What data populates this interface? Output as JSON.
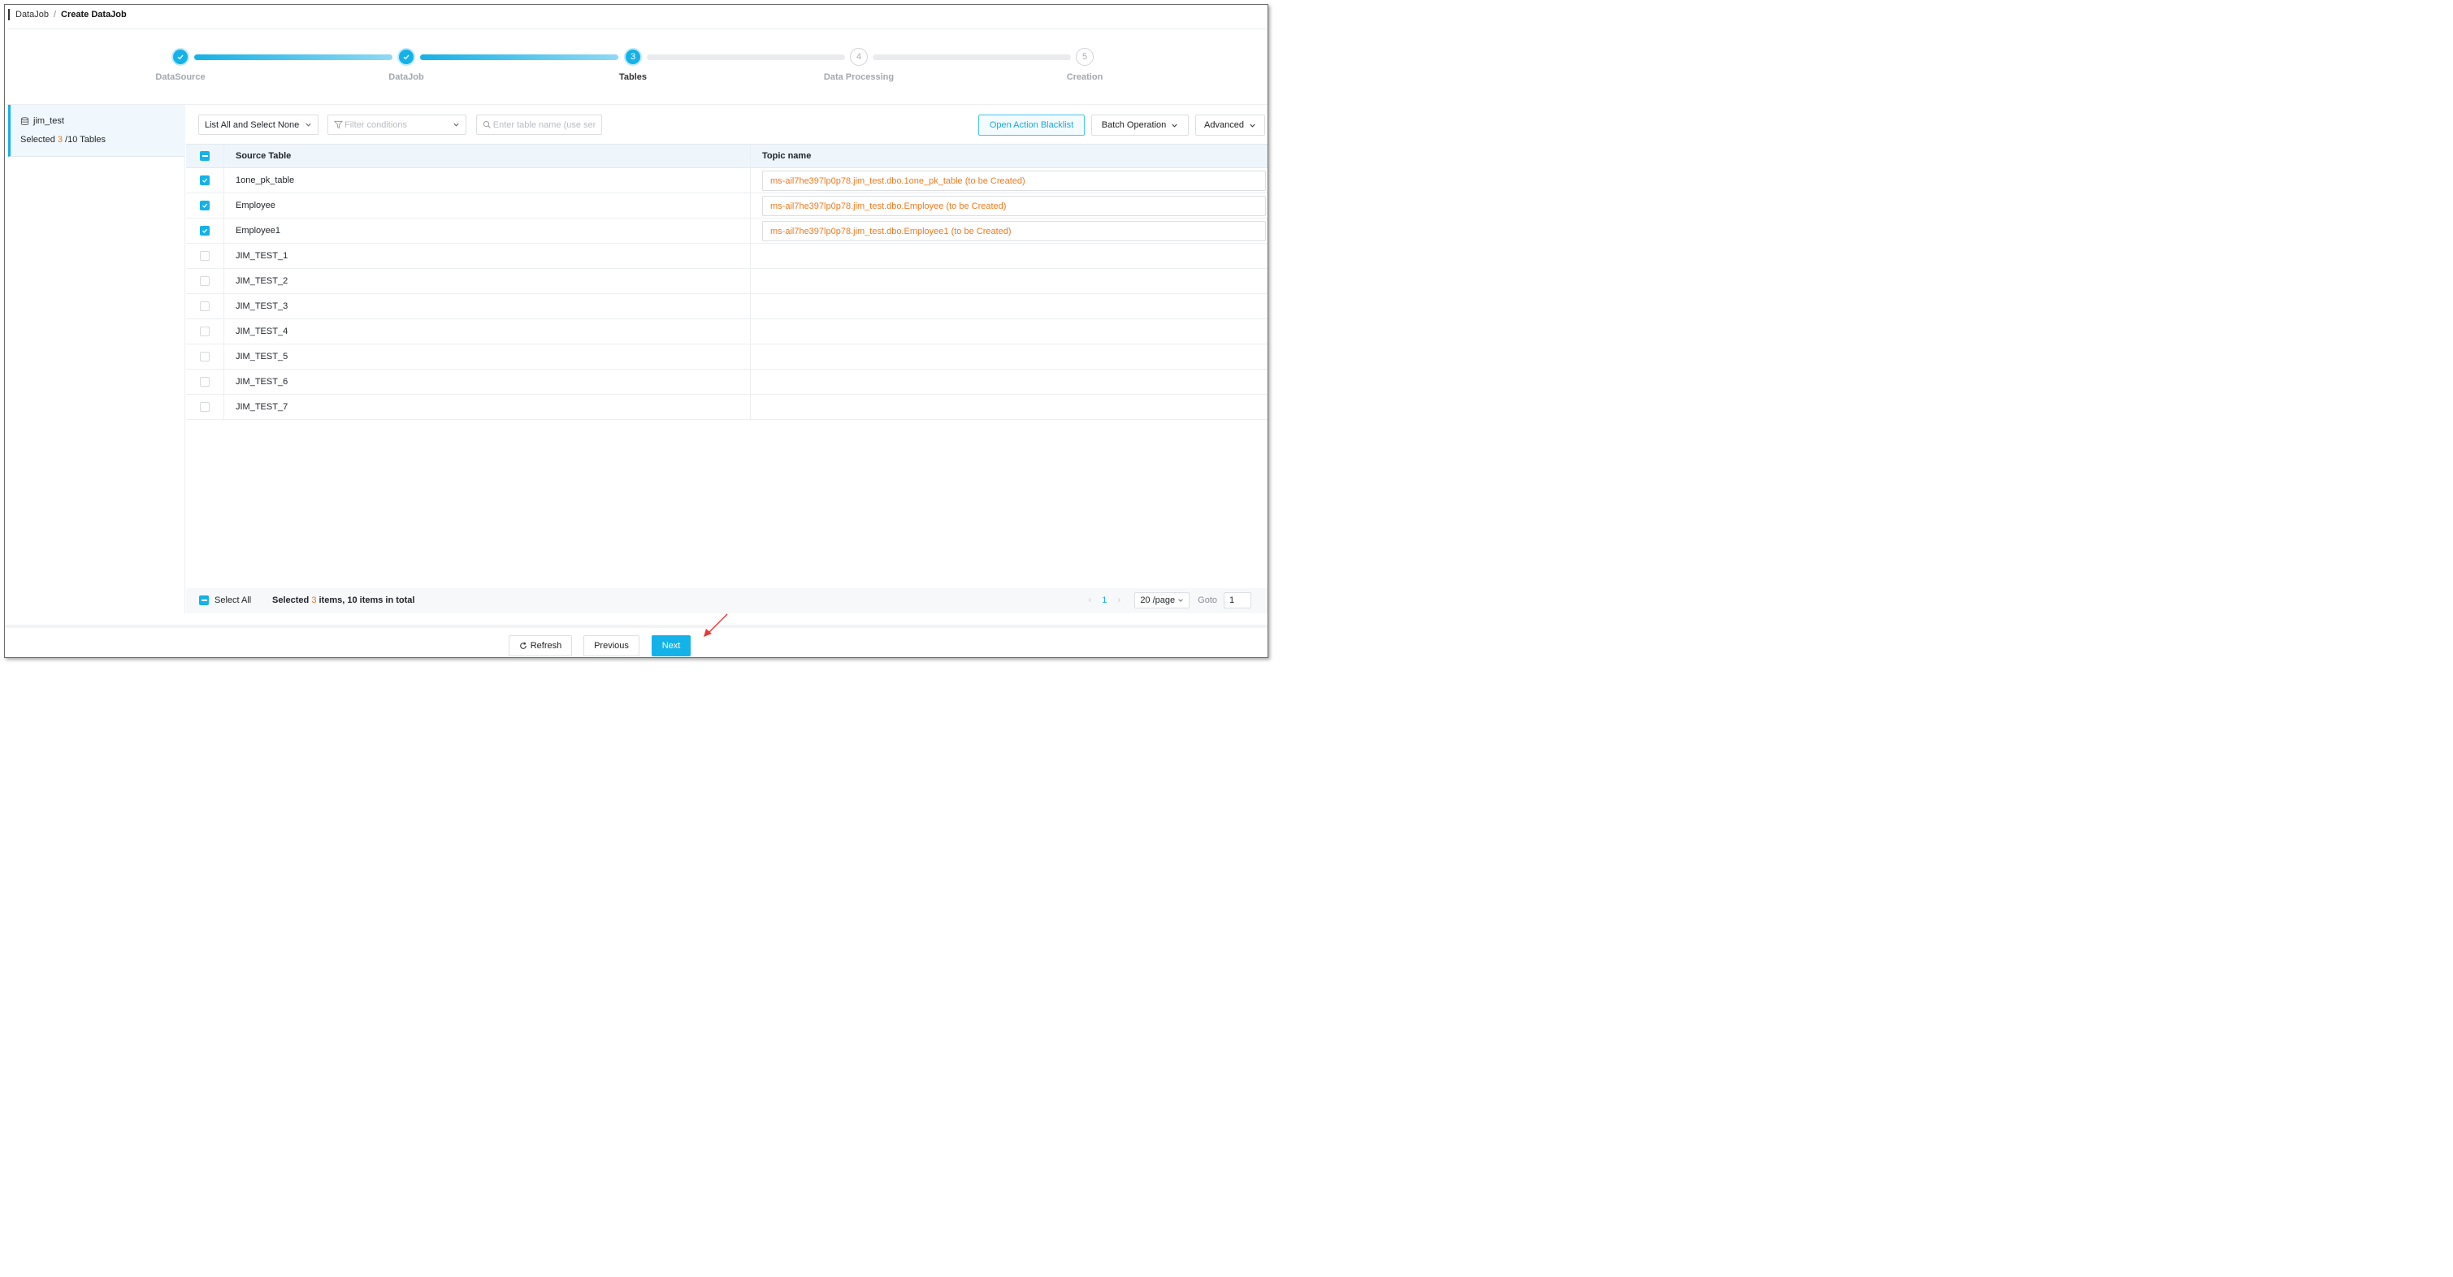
{
  "breadcrumb": {
    "items": [
      "DataJob",
      "Create DataJob"
    ],
    "separator": "/"
  },
  "steps": [
    {
      "label": "DataSource",
      "state": "done",
      "number": "1"
    },
    {
      "label": "DataJob",
      "state": "done",
      "number": "2"
    },
    {
      "label": "Tables",
      "state": "active",
      "number": "3"
    },
    {
      "label": "Data Processing",
      "state": "todo",
      "number": "4"
    },
    {
      "label": "Creation",
      "state": "todo",
      "number": "5"
    }
  ],
  "left_panel": {
    "db_name": "jim_test",
    "selected_prefix": "Selected ",
    "selected_count": "3",
    "selected_suffix": " /10 Tables"
  },
  "toolbar": {
    "list_select": "List All and Select None",
    "filter_placeholder": "Filter conditions",
    "search_placeholder": "Enter table name (use sen",
    "blacklist_button": "Open Action Blacklist",
    "batch_button": "Batch Operation",
    "advanced_button": "Advanced"
  },
  "table": {
    "headers": {
      "source": "Source Table",
      "topic": "Topic name"
    },
    "rows": [
      {
        "source": "1one_pk_table",
        "checked": true,
        "topic": "ms-ail7he397lp0p78.jim_test.dbo.1one_pk_table (to be Created)"
      },
      {
        "source": "Employee",
        "checked": true,
        "topic": "ms-ail7he397lp0p78.jim_test.dbo.Employee (to be Created)"
      },
      {
        "source": "Employee1",
        "checked": true,
        "topic": "ms-ail7he397lp0p78.jim_test.dbo.Employee1 (to be Created)"
      },
      {
        "source": "JIM_TEST_1",
        "checked": false,
        "topic": ""
      },
      {
        "source": "JIM_TEST_2",
        "checked": false,
        "topic": ""
      },
      {
        "source": "JIM_TEST_3",
        "checked": false,
        "topic": ""
      },
      {
        "source": "JIM_TEST_4",
        "checked": false,
        "topic": ""
      },
      {
        "source": "JIM_TEST_5",
        "checked": false,
        "topic": ""
      },
      {
        "source": "JIM_TEST_6",
        "checked": false,
        "topic": ""
      },
      {
        "source": "JIM_TEST_7",
        "checked": false,
        "topic": ""
      }
    ]
  },
  "footer": {
    "select_all": "Select All",
    "selected_prefix": "Selected ",
    "selected_count": "3",
    "selected_suffix": " items, 10 items in total",
    "page": "1",
    "per_page": "20 /page",
    "goto_label": "Goto",
    "goto_value": "1"
  },
  "actions": {
    "refresh": "Refresh",
    "previous": "Previous",
    "next": "Next"
  },
  "colors": {
    "accent": "#14b2e8",
    "highlight": "#f07a1e",
    "annotation_arrow": "#e53935"
  }
}
